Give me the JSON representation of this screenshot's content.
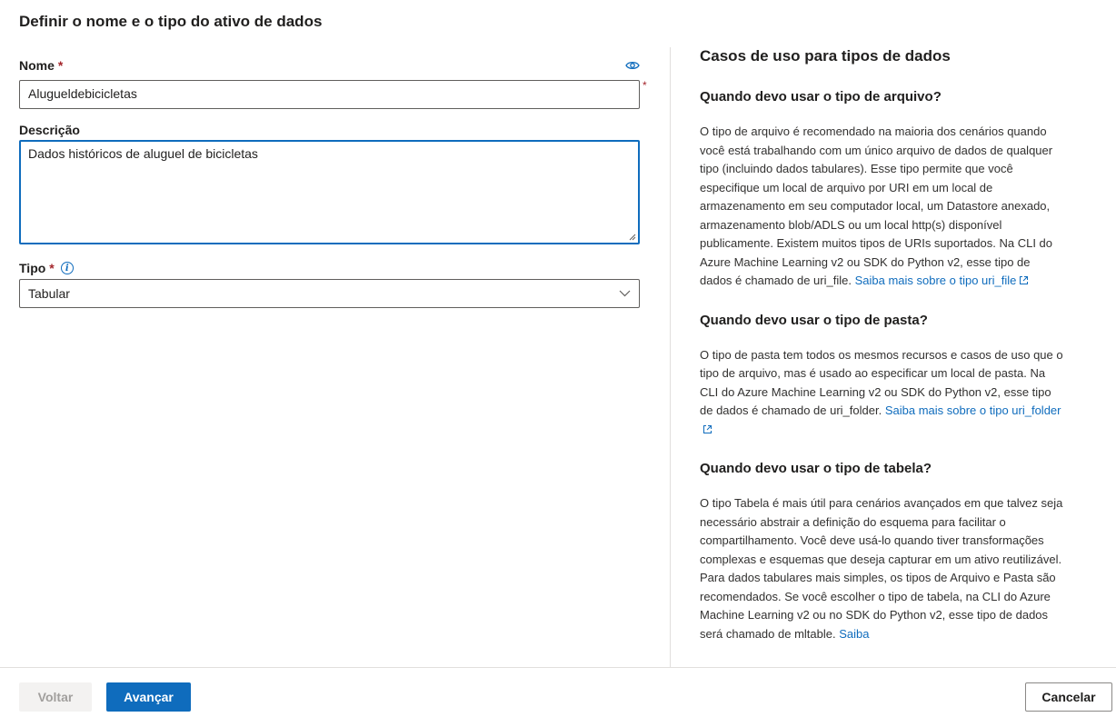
{
  "page": {
    "title": "Definir o nome e o tipo do ativo de dados"
  },
  "form": {
    "name_label": "Nome",
    "required_mark": "*",
    "name_value": "Alugueldebicicletas",
    "description_label": "Descrição",
    "description_value": "Dados históricos de aluguel de bicicletas",
    "type_label": "Tipo",
    "type_value": "Tabular"
  },
  "help_panel": {
    "heading": "Casos de uso para tipos de dados",
    "sections": [
      {
        "title": "Quando devo usar o tipo de arquivo?",
        "text": "O tipo de arquivo é recomendado na maioria dos cenários quando você está trabalhando com um único arquivo de dados de qualquer tipo (incluindo dados tabulares). Esse tipo permite que você especifique um local de arquivo por URI em um local de armazenamento em seu computador local, um Datastore anexado, armazenamento blob/ADLS ou um local http(s) disponível publicamente. Existem muitos tipos de URIs suportados. Na CLI do Azure Machine Learning v2 ou SDK do Python v2, esse tipo de dados é chamado de uri_file.",
        "link": "Saiba mais sobre o tipo uri_file"
      },
      {
        "title": "Quando devo usar o tipo de pasta?",
        "text": "O tipo de pasta tem todos os mesmos recursos e casos de uso que o tipo de arquivo, mas é usado ao especificar um local de pasta. Na CLI do Azure Machine Learning v2 ou SDK do Python v2, esse tipo de dados é chamado de uri_folder.",
        "link": "Saiba mais sobre o tipo uri_folder"
      },
      {
        "title": "Quando devo usar o tipo de tabela?",
        "text": "O tipo Tabela é mais útil para cenários avançados em que talvez seja necessário abstrair a definição do esquema para facilitar o compartilhamento. Você deve usá-lo quando tiver transformações complexas e esquemas que deseja capturar em um ativo reutilizável. Para dados tabulares mais simples, os tipos de Arquivo e Pasta são recomendados. Se você escolher o tipo de tabela, na CLI do Azure Machine Learning v2 ou no SDK do Python v2, esse tipo de dados será chamado de mltable.",
        "link": "Saiba"
      }
    ]
  },
  "footer": {
    "back_label": "Voltar",
    "next_label": "Avançar",
    "cancel_label": "Cancelar"
  }
}
